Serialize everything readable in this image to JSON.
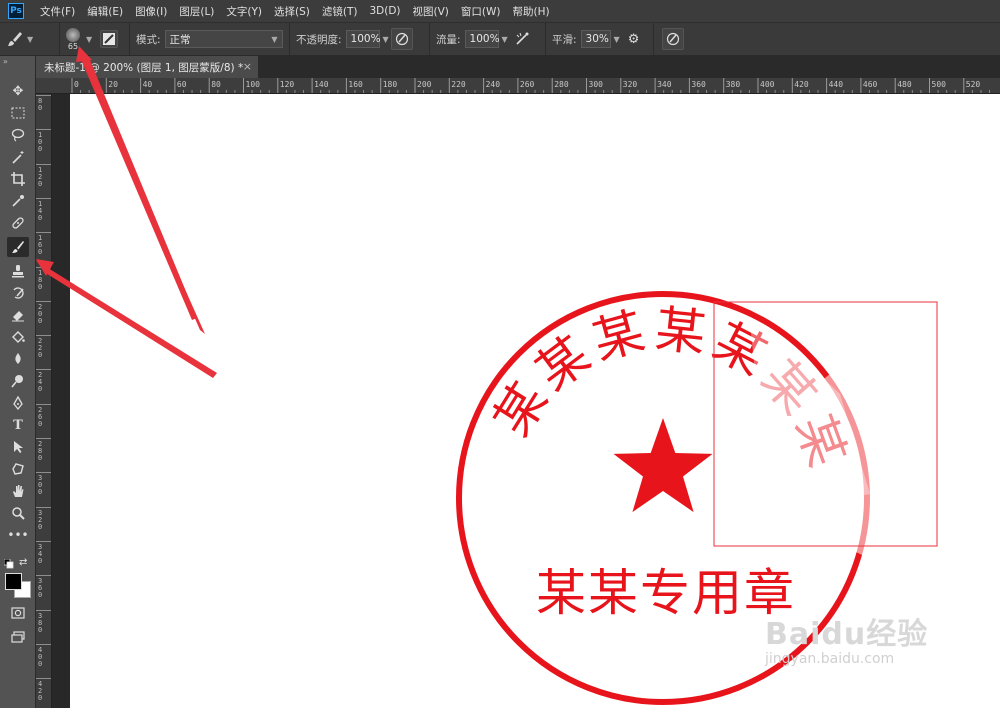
{
  "menubar": {
    "logo": "Ps",
    "items": [
      "文件(F)",
      "编辑(E)",
      "图像(I)",
      "图层(L)",
      "文字(Y)",
      "选择(S)",
      "滤镜(T)",
      "3D(D)",
      "视图(V)",
      "窗口(W)",
      "帮助(H)"
    ]
  },
  "options": {
    "brush_size": "65",
    "mode_label": "模式:",
    "mode_value": "正常",
    "opacity_label": "不透明度:",
    "opacity_value": "100%",
    "flow_label": "流量:",
    "flow_value": "100%",
    "smooth_label": "平滑:",
    "smooth_value": "30%"
  },
  "document": {
    "tab_title": "未标题-1 @ 200% (图层 1, 图层蒙版/8) *",
    "close": "×"
  },
  "ruler": {
    "h_ticks": [
      "0",
      "20",
      "40",
      "60",
      "80",
      "100",
      "120",
      "140",
      "160",
      "180",
      "200",
      "220",
      "240",
      "260",
      "280",
      "300",
      "320",
      "340",
      "360",
      "380",
      "400",
      "420",
      "440",
      "460",
      "480",
      "500",
      "520"
    ],
    "v_ticks": [
      "80",
      "100",
      "120",
      "140",
      "160",
      "180",
      "200",
      "220",
      "240",
      "260",
      "280",
      "300",
      "320",
      "340",
      "360",
      "380",
      "400",
      "420"
    ]
  },
  "tools": [
    "move-tool",
    "marquee-tool",
    "lasso-tool",
    "magic-wand-tool",
    "crop-tool",
    "eyedropper-tool",
    "healing-brush-tool",
    "brush-tool",
    "clone-stamp-tool",
    "history-brush-tool",
    "eraser-tool",
    "paint-bucket-tool",
    "blur-tool",
    "dodge-tool",
    "pen-tool",
    "type-tool",
    "path-selection-tool",
    "shape-tool",
    "hand-tool",
    "zoom-tool",
    "more-tools"
  ],
  "stamp": {
    "arc_chars": [
      "某",
      "某",
      "某",
      "某",
      "某",
      "某",
      "某"
    ],
    "bottom_text": "某某专用章",
    "color": "#e8141b"
  },
  "colors": {
    "foreground": "#000000",
    "background": "#ffffff",
    "arrow": "#e8323c"
  },
  "watermark": {
    "brand": "Baidu经验",
    "url": "jingyan.baidu.com"
  }
}
